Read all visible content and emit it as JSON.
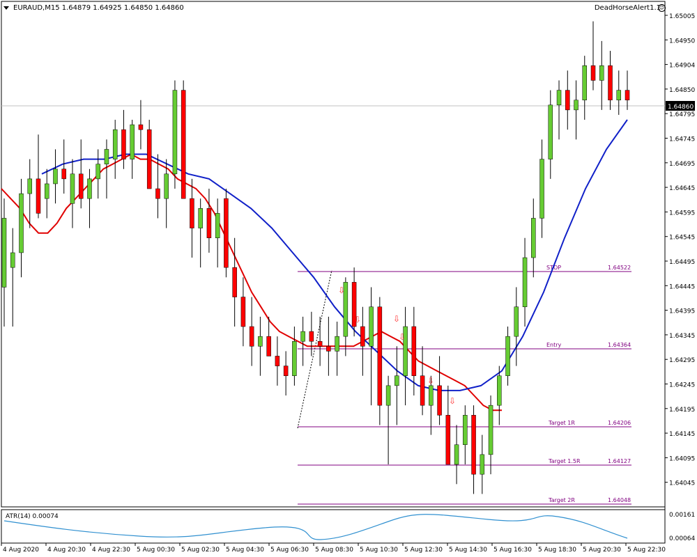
{
  "header": {
    "symbol_info": "EURAUD,M15  1.64879 1.64925 1.64850 1.64860",
    "indicator_name": "DeadHorseAlert1.1",
    "smiley_icon": "smiley-face-icon"
  },
  "price_axis": {
    "labels": [
      "1.65005",
      "1.64950",
      "1.64904",
      "1.64850",
      "1.64795",
      "1.64745",
      "1.64695",
      "1.64645",
      "1.64595",
      "1.64545",
      "1.64495",
      "1.64445",
      "1.64395",
      "1.64345",
      "1.64295",
      "1.64245",
      "1.64195",
      "1.64145",
      "1.64095",
      "1.64045"
    ],
    "current_price": "1.64860"
  },
  "levels": [
    {
      "name": "STOP",
      "value": "1.64522"
    },
    {
      "name": "Entry",
      "value": "1.64364"
    },
    {
      "name": "Target 1R",
      "value": "1.64206"
    },
    {
      "name": "Target 1.5R",
      "value": "1.64127"
    },
    {
      "name": "Target 2R",
      "value": "1.64048"
    }
  ],
  "atr": {
    "label": "ATR(14) 0.00074",
    "axis_labels": [
      "0.00161",
      "0.00064"
    ]
  },
  "time_axis": {
    "labels": [
      "4 Aug 2020",
      "4 Aug 20:30",
      "4 Aug 22:30",
      "5 Aug 00:30",
      "5 Aug 02:30",
      "5 Aug 04:30",
      "5 Aug 06:30",
      "5 Aug 08:30",
      "5 Aug 10:30",
      "5 Aug 12:30",
      "5 Aug 14:30",
      "5 Aug 16:30",
      "5 Aug 18:30",
      "5 Aug 20:30",
      "5 Aug 22:30"
    ]
  },
  "colors": {
    "bull": "#66cc33",
    "bear": "#ff0000",
    "neutral": "#d28b6e",
    "ma_red": "#e00000",
    "ma_blue": "#1020c8",
    "level_line": "#800080",
    "level_text": "#800080",
    "atr_line": "#3090d0",
    "signal_arrow": "#ff3333",
    "current_price_bg": "#000000",
    "current_price_fg": "#ffffff"
  },
  "chart_data": {
    "type": "candlestick",
    "symbol": "EURAUD",
    "timeframe": "M15",
    "ylim": [
      1.64038,
      1.65035
    ],
    "candles": [
      {
        "o": 1.6448,
        "h": 1.6466,
        "l": 1.644,
        "c": 1.6462
      },
      {
        "o": 1.6452,
        "h": 1.646,
        "l": 1.644,
        "c": 1.6455
      },
      {
        "o": 1.6455,
        "h": 1.647,
        "l": 1.645,
        "c": 1.6467
      },
      {
        "o": 1.6467,
        "h": 1.6474,
        "l": 1.646,
        "c": 1.647
      },
      {
        "o": 1.647,
        "h": 1.6479,
        "l": 1.6462,
        "c": 1.6463
      },
      {
        "o": 1.6466,
        "h": 1.6472,
        "l": 1.6462,
        "c": 1.6469
      },
      {
        "o": 1.6469,
        "h": 1.6476,
        "l": 1.6465,
        "c": 1.6472
      },
      {
        "o": 1.6472,
        "h": 1.6478,
        "l": 1.6467,
        "c": 1.647
      },
      {
        "o": 1.6465,
        "h": 1.6474,
        "l": 1.646,
        "c": 1.6471
      },
      {
        "o": 1.6471,
        "h": 1.6478,
        "l": 1.6464,
        "c": 1.6466
      },
      {
        "o": 1.6466,
        "h": 1.6472,
        "l": 1.646,
        "c": 1.647
      },
      {
        "o": 1.647,
        "h": 1.6476,
        "l": 1.6466,
        "c": 1.6473
      },
      {
        "o": 1.6473,
        "h": 1.6478,
        "l": 1.6466,
        "c": 1.6476
      },
      {
        "o": 1.6474,
        "h": 1.6482,
        "l": 1.647,
        "c": 1.648
      },
      {
        "o": 1.648,
        "h": 1.6484,
        "l": 1.6472,
        "c": 1.6474
      },
      {
        "o": 1.6474,
        "h": 1.6482,
        "l": 1.647,
        "c": 1.6481
      },
      {
        "o": 1.6481,
        "h": 1.6486,
        "l": 1.6476,
        "c": 1.648
      },
      {
        "o": 1.648,
        "h": 1.6482,
        "l": 1.6468,
        "c": 1.6468
      },
      {
        "o": 1.6468,
        "h": 1.6475,
        "l": 1.6462,
        "c": 1.6466
      },
      {
        "o": 1.6466,
        "h": 1.6474,
        "l": 1.646,
        "c": 1.6471
      },
      {
        "o": 1.6471,
        "h": 1.649,
        "l": 1.6468,
        "c": 1.6488
      },
      {
        "o": 1.6488,
        "h": 1.649,
        "l": 1.648,
        "c": 1.6466
      },
      {
        "o": 1.6466,
        "h": 1.647,
        "l": 1.6454,
        "c": 1.646
      },
      {
        "o": 1.646,
        "h": 1.6466,
        "l": 1.6452,
        "c": 1.6464
      },
      {
        "o": 1.6464,
        "h": 1.6468,
        "l": 1.6455,
        "c": 1.6458
      },
      {
        "o": 1.6458,
        "h": 1.6466,
        "l": 1.6452,
        "c": 1.6463
      },
      {
        "o": 1.6466,
        "h": 1.6468,
        "l": 1.645,
        "c": 1.6452
      },
      {
        "o": 1.6452,
        "h": 1.6458,
        "l": 1.644,
        "c": 1.6446
      },
      {
        "o": 1.6446,
        "h": 1.645,
        "l": 1.6436,
        "c": 1.644
      },
      {
        "o": 1.644,
        "h": 1.6446,
        "l": 1.6432,
        "c": 1.6436
      },
      {
        "o": 1.6436,
        "h": 1.6442,
        "l": 1.643,
        "c": 1.6438
      },
      {
        "o": 1.6438,
        "h": 1.6442,
        "l": 1.6434,
        "c": 1.6434
      },
      {
        "o": 1.6434,
        "h": 1.6438,
        "l": 1.6428,
        "c": 1.6432
      },
      {
        "o": 1.6432,
        "h": 1.6435,
        "l": 1.6426,
        "c": 1.643
      },
      {
        "o": 1.643,
        "h": 1.644,
        "l": 1.6428,
        "c": 1.6437
      },
      {
        "o": 1.6437,
        "h": 1.6442,
        "l": 1.6432,
        "c": 1.6439
      },
      {
        "o": 1.6439,
        "h": 1.6443,
        "l": 1.6434,
        "c": 1.6437
      },
      {
        "o": 1.6437,
        "h": 1.6442,
        "l": 1.6432,
        "c": 1.6436
      },
      {
        "o": 1.6436,
        "h": 1.6442,
        "l": 1.643,
        "c": 1.6435
      },
      {
        "o": 1.6435,
        "h": 1.6441,
        "l": 1.643,
        "c": 1.6438
      },
      {
        "o": 1.6438,
        "h": 1.645,
        "l": 1.6434,
        "c": 1.6449
      },
      {
        "o": 1.6449,
        "h": 1.6452,
        "l": 1.6438,
        "c": 1.644
      },
      {
        "o": 1.644,
        "h": 1.6444,
        "l": 1.643,
        "c": 1.6436
      },
      {
        "o": 1.6436,
        "h": 1.6448,
        "l": 1.6424,
        "c": 1.6444
      },
      {
        "o": 1.6444,
        "h": 1.6446,
        "l": 1.642,
        "c": 1.6424
      },
      {
        "o": 1.6424,
        "h": 1.643,
        "l": 1.6412,
        "c": 1.6428
      },
      {
        "o": 1.6428,
        "h": 1.6436,
        "l": 1.642,
        "c": 1.643
      },
      {
        "o": 1.643,
        "h": 1.6444,
        "l": 1.6424,
        "c": 1.644
      },
      {
        "o": 1.644,
        "h": 1.6444,
        "l": 1.6426,
        "c": 1.643
      },
      {
        "o": 1.643,
        "h": 1.6436,
        "l": 1.6422,
        "c": 1.6424
      },
      {
        "o": 1.6424,
        "h": 1.643,
        "l": 1.6418,
        "c": 1.6428
      },
      {
        "o": 1.6428,
        "h": 1.6434,
        "l": 1.642,
        "c": 1.6422
      },
      {
        "o": 1.6422,
        "h": 1.6428,
        "l": 1.6412,
        "c": 1.6412
      },
      {
        "o": 1.6412,
        "h": 1.642,
        "l": 1.6408,
        "c": 1.6416
      },
      {
        "o": 1.6416,
        "h": 1.6424,
        "l": 1.6412,
        "c": 1.6422
      },
      {
        "o": 1.6422,
        "h": 1.6424,
        "l": 1.6406,
        "c": 1.641
      },
      {
        "o": 1.641,
        "h": 1.6418,
        "l": 1.6406,
        "c": 1.6414
      },
      {
        "o": 1.6414,
        "h": 1.6426,
        "l": 1.641,
        "c": 1.6424
      },
      {
        "o": 1.6424,
        "h": 1.6432,
        "l": 1.642,
        "c": 1.643
      },
      {
        "o": 1.643,
        "h": 1.644,
        "l": 1.6428,
        "c": 1.6438
      },
      {
        "o": 1.6438,
        "h": 1.6448,
        "l": 1.6432,
        "c": 1.6444
      },
      {
        "o": 1.6444,
        "h": 1.6458,
        "l": 1.644,
        "c": 1.6454
      },
      {
        "o": 1.6454,
        "h": 1.6466,
        "l": 1.645,
        "c": 1.6462
      },
      {
        "o": 1.6462,
        "h": 1.6478,
        "l": 1.6458,
        "c": 1.6474
      },
      {
        "o": 1.6474,
        "h": 1.6488,
        "l": 1.647,
        "c": 1.6485
      },
      {
        "o": 1.6485,
        "h": 1.649,
        "l": 1.6478,
        "c": 1.6488
      },
      {
        "o": 1.6488,
        "h": 1.6492,
        "l": 1.648,
        "c": 1.6484
      },
      {
        "o": 1.6484,
        "h": 1.649,
        "l": 1.6478,
        "c": 1.6486
      },
      {
        "o": 1.6486,
        "h": 1.6495,
        "l": 1.6482,
        "c": 1.6493
      },
      {
        "o": 1.6493,
        "h": 1.6502,
        "l": 1.6488,
        "c": 1.649
      },
      {
        "o": 1.649,
        "h": 1.6498,
        "l": 1.6484,
        "c": 1.6493
      },
      {
        "o": 1.6493,
        "h": 1.6496,
        "l": 1.6484,
        "c": 1.6486
      },
      {
        "o": 1.6486,
        "h": 1.6492,
        "l": 1.6483,
        "c": 1.6488
      },
      {
        "o": 1.6488,
        "h": 1.6492,
        "l": 1.6484,
        "c": 1.6486
      }
    ],
    "ma_red": [
      1.6468,
      1.6466,
      1.6464,
      1.6461,
      1.6459,
      1.6459,
      1.6461,
      1.6464,
      1.6466,
      1.6468,
      1.647,
      1.6472,
      1.6473,
      1.6474,
      1.6475,
      1.6474,
      1.6474,
      1.6473,
      1.6472,
      1.647,
      1.6469,
      1.6468,
      1.6466,
      1.6463,
      1.6459,
      1.6455,
      1.6451,
      1.6447,
      1.6444,
      1.6441,
      1.6439,
      1.6438,
      1.6437,
      1.6436,
      1.6436,
      1.6436,
      1.6436,
      1.6436,
      1.6436,
      1.6437,
      1.6438,
      1.6439,
      1.6438,
      1.6437,
      1.6435,
      1.6433,
      1.6432,
      1.6431,
      1.643,
      1.6429,
      1.6428,
      1.6426,
      1.6424,
      1.6423,
      1.6423
    ],
    "ma_blue": [
      1.6471,
      1.6473,
      1.6474,
      1.6474,
      1.6475,
      1.6475,
      1.6473,
      1.6471,
      1.647,
      1.6467,
      1.6464,
      1.646,
      1.6455,
      1.645,
      1.6444,
      1.6439,
      1.6435,
      1.6431,
      1.6428,
      1.6427,
      1.6427,
      1.6428,
      1.6431,
      1.6438,
      1.6447,
      1.6458,
      1.6468,
      1.6476,
      1.6482
    ]
  }
}
